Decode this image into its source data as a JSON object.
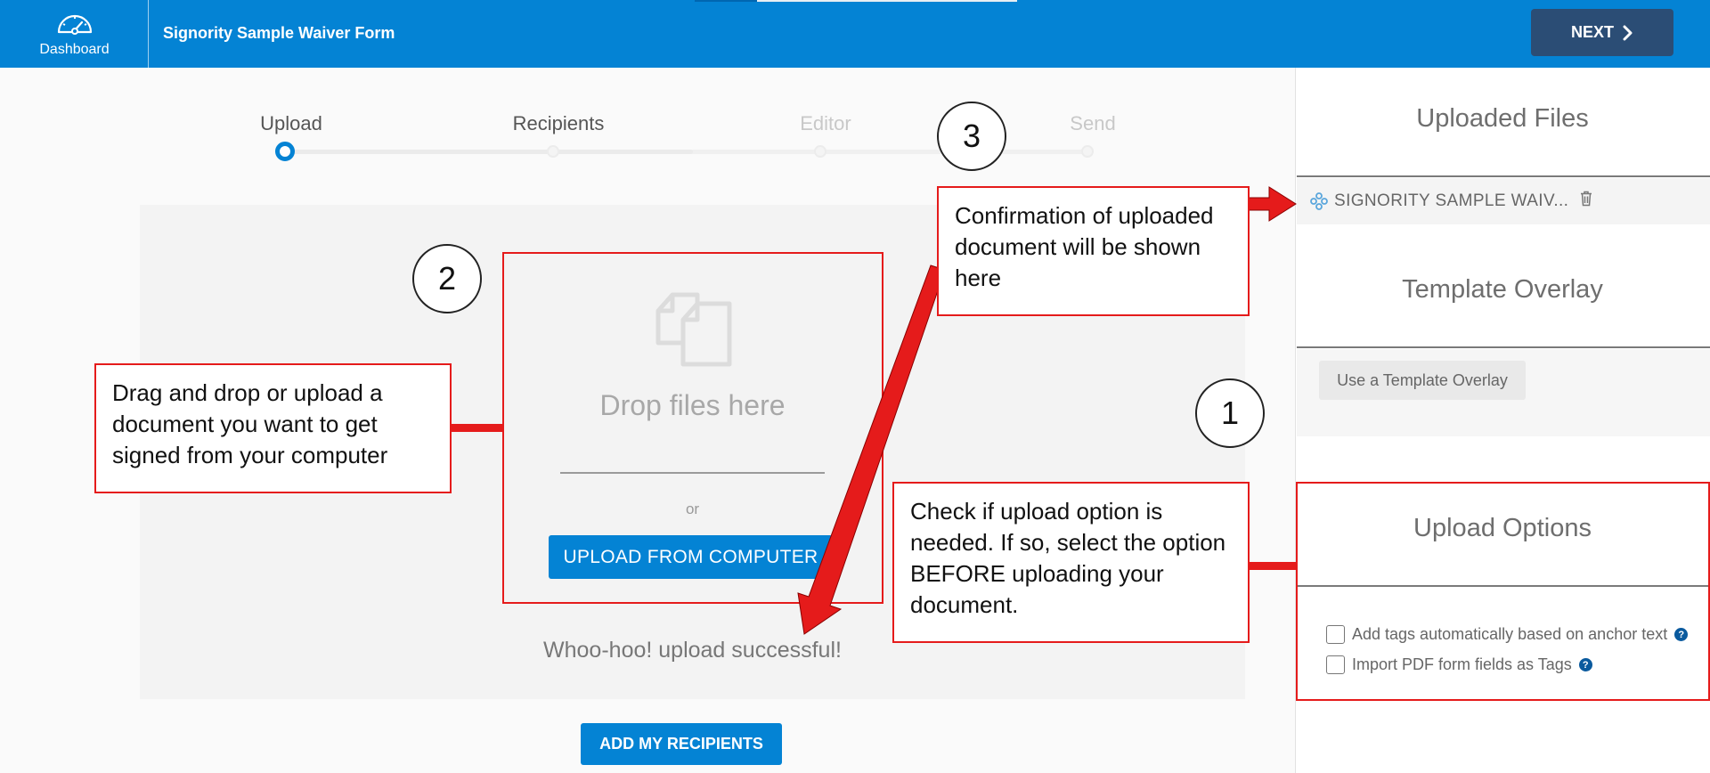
{
  "header": {
    "dashboard_label": "Dashboard",
    "document_title": "Signority Sample Waiver Form",
    "next_label": "NEXT"
  },
  "stepper": {
    "steps": [
      {
        "label": "Upload",
        "state": "active"
      },
      {
        "label": "Recipients",
        "state": "enabled"
      },
      {
        "label": "Editor",
        "state": "disabled"
      },
      {
        "label": "Send",
        "state": "disabled"
      }
    ]
  },
  "upload": {
    "drop_text": "Drop files here",
    "or_text": "or",
    "upload_button": "UPLOAD FROM COMPUTER",
    "success_text": "Whoo-hoo! upload successful!",
    "add_recipients_button": "ADD MY RECIPIENTS"
  },
  "sidebar": {
    "uploaded_files_heading": "Uploaded Files",
    "files": [
      {
        "name": "SIGNORITY SAMPLE WAIV..."
      }
    ],
    "template_heading": "Template Overlay",
    "template_button": "Use a Template Overlay",
    "upload_options_heading": "Upload Options",
    "options": [
      {
        "label": "Add tags automatically based on anchor text",
        "checked": false
      },
      {
        "label": "Import PDF form fields as Tags",
        "checked": false
      }
    ]
  },
  "annotations": {
    "step1_number": "1",
    "step2_number": "2",
    "step3_number": "3",
    "drag_drop_note": "Drag and drop or upload a document you want to get signed from your computer",
    "confirmation_note": "Confirmation of uploaded document will be shown here",
    "upload_option_note": "Check if upload option is needed. If so, select the option BEFORE uploading your document."
  },
  "colors": {
    "header_blue": "#0483d4",
    "next_button": "#2b4d75",
    "annotation_red": "#e51b1b"
  }
}
